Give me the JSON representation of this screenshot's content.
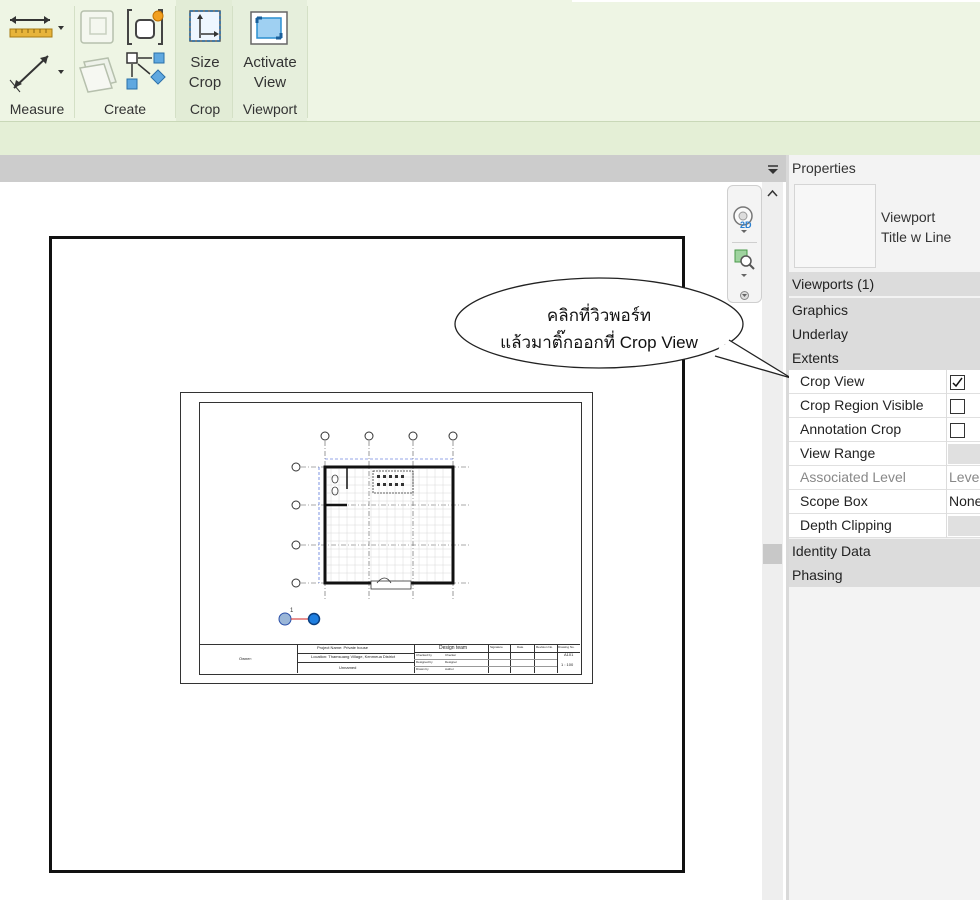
{
  "ribbon": {
    "panels": [
      {
        "label": "Measure"
      },
      {
        "label": "Create"
      },
      {
        "label": "Crop"
      },
      {
        "label": "Viewport"
      }
    ],
    "buttons": {
      "size_crop": [
        "Size",
        "Crop"
      ],
      "activate_view": [
        "Activate",
        "View"
      ]
    }
  },
  "navbar": {
    "wheel_label": "2D"
  },
  "properties": {
    "title": "Properties",
    "type_name": [
      "Viewport",
      "Title w Line"
    ],
    "selector": "Viewports (1)",
    "groups": {
      "graphics": "Graphics",
      "underlay": "Underlay",
      "extents": "Extents",
      "identity": "Identity Data",
      "phasing": "Phasing"
    },
    "rows": [
      {
        "name": "Crop View",
        "checked": true
      },
      {
        "name": "Crop Region Visible",
        "checked": false
      },
      {
        "name": "Annotation Crop",
        "checked": false
      },
      {
        "name": "View Range",
        "value": ""
      },
      {
        "name": "Associated Level",
        "value": "Leve"
      },
      {
        "name": "Scope Box",
        "value": "None"
      },
      {
        "name": "Depth Clipping",
        "value": ""
      }
    ]
  },
  "callout": {
    "lines": [
      "คลิกที่วิวพอร์ท",
      "แล้วมาติ๊กออกที่ Crop View"
    ]
  },
  "sheet": {
    "title_block": {
      "owner_label": "Owner:",
      "project_name": "Project Name: Private house",
      "location": "Location: Thamsuang Village, Kenmeua District",
      "unnamed": "Unnamed",
      "design_team": "Design team",
      "cols": [
        "Signature",
        "Date",
        "Revision No.",
        "Drawing No."
      ],
      "rows": [
        "Checked by",
        "Designed by",
        "Drawn by"
      ],
      "row_values": [
        "Checker",
        "Designer",
        "Author"
      ],
      "drawing_no": "A101",
      "scale": "1 : 100"
    },
    "view_title": "1"
  }
}
